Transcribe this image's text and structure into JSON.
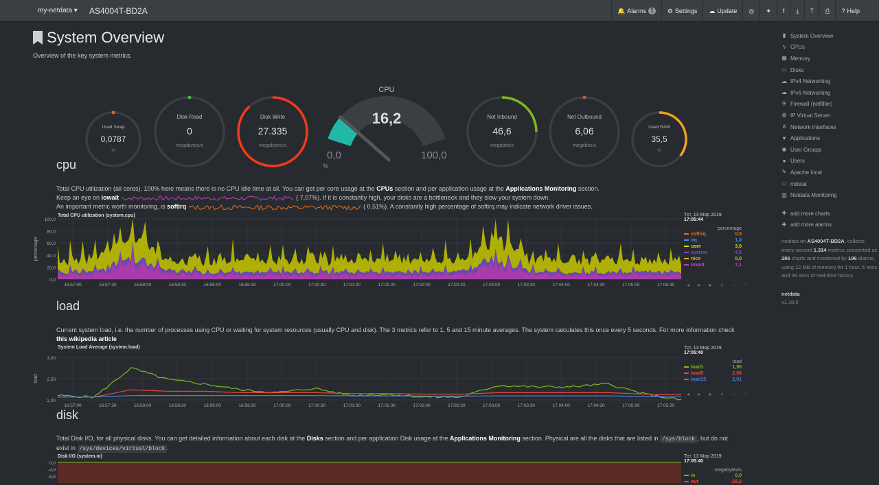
{
  "topbar": {
    "host": "my-netdata ▾",
    "title": "AS4004T-BD2A",
    "buttons": [
      {
        "icon": "bell-icon",
        "glyph": "🔔",
        "label": "Alarms",
        "badge": "1"
      },
      {
        "icon": "gear-icon",
        "glyph": "⚙",
        "label": "Settings"
      },
      {
        "icon": "cloud-download-icon",
        "glyph": "☁",
        "label": "Update"
      },
      {
        "icon": "github-icon",
        "glyph": "◎",
        "label": ""
      },
      {
        "icon": "twitter-icon",
        "glyph": "✦",
        "label": ""
      },
      {
        "icon": "facebook-icon",
        "glyph": "f",
        "label": ""
      },
      {
        "icon": "download-icon",
        "glyph": "⤓",
        "label": ""
      },
      {
        "icon": "upload-icon",
        "glyph": "⤒",
        "label": ""
      },
      {
        "icon": "print-icon",
        "glyph": "⎙",
        "label": ""
      },
      {
        "icon": "help-icon",
        "glyph": "?",
        "label": "Help"
      }
    ]
  },
  "page": {
    "title": "System Overview",
    "subtitle": "Overview of the key system metrics."
  },
  "gauges": {
    "swap": {
      "label": "Used Swap",
      "value": "0,0787",
      "unit": "%",
      "fraction": 0.0,
      "color": "#ff5722"
    },
    "disk_read": {
      "label": "Disk Read",
      "value": "0",
      "unit": "megabytes/s",
      "fraction": 0.0,
      "color": "#4caf50"
    },
    "disk_write": {
      "label": "Disk Write",
      "value": "27.335",
      "unit": "megabytes/s",
      "fraction": 0.88,
      "color": "#f4391c"
    },
    "cpu": {
      "label": "CPU",
      "value": "16,2",
      "min": "0,0",
      "max": "100,0",
      "unit": "%",
      "fraction": 0.162,
      "color": "#22b8a8"
    },
    "net_in": {
      "label": "Net Inbound",
      "value": "46,6",
      "unit": "megabits/s",
      "fraction": 0.25,
      "color": "#7cbb1d"
    },
    "net_out": {
      "label": "Net Outbound",
      "value": "6,06",
      "unit": "megabits/s",
      "fraction": 0.0,
      "color": "#e84a3c"
    },
    "ram": {
      "label": "Used RAM",
      "value": "35,5",
      "unit": "%",
      "fraction": 0.355,
      "color": "#f3a120"
    }
  },
  "sections": {
    "cpu": {
      "title": "cpu",
      "line1_a": "Total CPU utilization (all cores). 100% here means there is no CPU idle time at all. You can get per core usage at the ",
      "line1_b": "CPUs",
      "line1_c": " section and per application usage at the ",
      "line1_d": "Applications Monitoring",
      "line1_e": " section.",
      "line2_a": "Keep an eye on ",
      "line2_b": "iowait",
      "line2_c": "( 7,07%). If it is constantly high, your disks are a bottleneck and they slow your system down.",
      "line3_a": "An important metric worth monitoring, is ",
      "line3_b": "softirq",
      "line3_c": "( 0,51%). A constantly high percentage of softirq may indicate network driver issues."
    },
    "load": {
      "title": "load",
      "text_a": "Current system load, i.e. the number of processes using CPU or waiting for system resources (usually CPU and disk). The 3 metrics refer to 1, 5 and 15 minute averages. The system calculates this once every 5 seconds. For more information check ",
      "text_b": "this wikipedia article"
    },
    "disk": {
      "title": "disk",
      "text_a": "Total Disk I/O, for all physical disks. You can get detailed information about each disk at the ",
      "text_b": "Disks",
      "text_c": " section and per application Disk usage at the ",
      "text_d": "Applications Monitoring",
      "text_e": " section. Physical are all the disks that are listed in ",
      "code1": "/sys/block",
      "text_f": ", but do not exist in ",
      "code2": "/sys/devices/virtual/block",
      "text_g": "."
    }
  },
  "charts": {
    "cpu": {
      "title": "Total CPU utilization (system.cpu)",
      "ylabel": "percentage",
      "yticks": [
        "100,0",
        "80,0",
        "60,0",
        "40,0",
        "20,0",
        "0,0"
      ],
      "xticks": [
        "16:57:00",
        "16:57:30",
        "16:58:00",
        "16:58:30",
        "16:59:00",
        "16:59:30",
        "17:00:00",
        "17:00:30",
        "17:01:00",
        "17:01:30",
        "17:02:00",
        "17:02:30",
        "17:03:00",
        "17:03:30",
        "17:04:00",
        "17:04:30",
        "17:05:00",
        "17:05:30"
      ],
      "date": "Тст, 13 Мор 2019",
      "time": "17:05:44",
      "units": "percentage",
      "legend": [
        {
          "name": "softirq",
          "value": "0,5",
          "color": "#e07020"
        },
        {
          "name": "irq",
          "value": "1,0",
          "color": "#4a90d9"
        },
        {
          "name": "user",
          "value": "3,0",
          "color": "#dddd00"
        },
        {
          "name": "system",
          "value": "4,5",
          "color": "#7b4ccc"
        },
        {
          "name": "nice",
          "value": "0,0",
          "color": "#e8b010"
        },
        {
          "name": "iowait",
          "value": "7,1",
          "color": "#c040c0"
        }
      ]
    },
    "load": {
      "title": "System Load Average (system.load)",
      "ylabel": "load",
      "yticks": [
        "3,00",
        "2,50",
        "2,00"
      ],
      "xticks": [
        "16:57:00",
        "16:57:30",
        "16:58:00",
        "16:58:30",
        "16:59:00",
        "16:59:30",
        "17:00:00",
        "17:00:30",
        "17:01:00",
        "17:01:30",
        "17:02:00",
        "17:02:30",
        "17:03:00",
        "17:03:30",
        "17:04:00",
        "17:04:30",
        "17:05:00",
        "17:05:30"
      ],
      "date": "Тст, 13 Мор 2019",
      "time": "17:05:40",
      "units": "load",
      "legend": [
        {
          "name": "load1",
          "value": "1,90",
          "color": "#7cbb1d"
        },
        {
          "name": "load5",
          "value": "2,08",
          "color": "#e84a3c"
        },
        {
          "name": "load15",
          "value": "2,01",
          "color": "#4a7fd9"
        }
      ]
    },
    "disk": {
      "title": "Disk I/O (system.io)",
      "yticks": [
        "0,0",
        "-4,9",
        "-9,8"
      ],
      "date": "Тст, 13 Мор 2019",
      "time": "17:05:40",
      "units": "megabytes/s",
      "legend": [
        {
          "name": "in",
          "value": "0,0",
          "color": "#7cbb1d"
        },
        {
          "name": "out",
          "value": "-29,2",
          "color": "#e84a3c"
        }
      ]
    }
  },
  "chart_data": [
    {
      "type": "area",
      "title": "Total CPU utilization (system.cpu)",
      "ylabel": "percentage",
      "ylim": [
        0,
        100
      ],
      "x": [
        "16:57:00",
        "16:57:30",
        "16:58:00",
        "16:58:30",
        "16:59:00",
        "16:59:30",
        "17:00:00",
        "17:00:30",
        "17:01:00",
        "17:01:30",
        "17:02:00",
        "17:02:30",
        "17:03:00",
        "17:03:30",
        "17:04:00",
        "17:04:30",
        "17:05:00",
        "17:05:30"
      ],
      "series": [
        {
          "name": "iowait",
          "values": [
            7,
            8,
            25,
            9,
            7,
            6,
            7,
            8,
            7,
            6,
            7,
            8,
            25,
            7,
            6,
            7,
            7,
            7
          ]
        },
        {
          "name": "system",
          "values": [
            5,
            5,
            8,
            5,
            4,
            5,
            5,
            5,
            4,
            5,
            5,
            5,
            8,
            5,
            4,
            5,
            5,
            4
          ]
        },
        {
          "name": "user",
          "values": [
            20,
            22,
            45,
            18,
            20,
            22,
            18,
            24,
            20,
            22,
            20,
            18,
            40,
            20,
            22,
            20,
            18,
            20
          ]
        }
      ]
    },
    {
      "type": "line",
      "title": "System Load Average (system.load)",
      "ylabel": "load",
      "ylim": [
        1.9,
        3.1
      ],
      "x": [
        "16:57:00",
        "16:57:30",
        "16:58:00",
        "16:58:30",
        "16:59:00",
        "16:59:30",
        "17:00:00",
        "17:00:30",
        "17:01:00",
        "17:01:30",
        "17:02:00",
        "17:02:30",
        "17:03:00",
        "17:03:30",
        "17:04:00",
        "17:04:30",
        "17:05:00",
        "17:05:30"
      ],
      "series": [
        {
          "name": "load1",
          "values": [
            2.05,
            2.0,
            3.0,
            2.6,
            2.45,
            2.25,
            2.15,
            2.3,
            2.05,
            2.1,
            2.0,
            2.0,
            2.4,
            2.35,
            2.35,
            2.45,
            2.1,
            1.9
          ]
        },
        {
          "name": "load5",
          "values": [
            2.0,
            2.0,
            2.25,
            2.2,
            2.2,
            2.15,
            2.15,
            2.15,
            2.12,
            2.12,
            2.1,
            2.1,
            2.15,
            2.15,
            2.15,
            2.15,
            2.1,
            2.08
          ]
        },
        {
          "name": "load15",
          "values": [
            2.0,
            2.0,
            2.05,
            2.05,
            2.05,
            2.05,
            2.05,
            2.05,
            2.04,
            2.04,
            2.03,
            2.03,
            2.04,
            2.04,
            2.04,
            2.04,
            2.02,
            2.01
          ]
        }
      ]
    }
  ],
  "sidebar": {
    "items": [
      {
        "icon": "bookmark-icon",
        "glyph": "▮",
        "label": "System Overview"
      },
      {
        "icon": "bolt-icon",
        "glyph": "ϟ",
        "label": "CPUs"
      },
      {
        "icon": "memory-icon",
        "glyph": "▦",
        "label": "Memory"
      },
      {
        "icon": "hdd-icon",
        "glyph": "▭",
        "label": "Disks"
      },
      {
        "icon": "cloud-icon",
        "glyph": "☁",
        "label": "IPv4 Networking"
      },
      {
        "icon": "cloud-icon",
        "glyph": "☁",
        "label": "IPv6 Networking"
      },
      {
        "icon": "shield-icon",
        "glyph": "⛨",
        "label": "Firewall (netfilter)"
      },
      {
        "icon": "globe-icon",
        "glyph": "◍",
        "label": "IP Virtual Server"
      },
      {
        "icon": "sitemap-icon",
        "glyph": "⋔",
        "label": "Network Interfaces"
      },
      {
        "icon": "heartbeat-icon",
        "glyph": "♥",
        "label": "Applications"
      },
      {
        "icon": "users-icon",
        "glyph": "◉",
        "label": "User Groups"
      },
      {
        "icon": "user-icon",
        "glyph": "●",
        "label": "Users"
      },
      {
        "icon": "feather-icon",
        "glyph": "✎",
        "label": "Apache local"
      },
      {
        "icon": "hdd-icon",
        "glyph": "▭",
        "label": "mdstat"
      },
      {
        "icon": "bar-chart-icon",
        "glyph": "▥",
        "label": "Netdata Monitoring"
      }
    ],
    "add_charts": "add more charts",
    "add_alarms": "add more alarms",
    "info_a": "netdata on ",
    "info_host": "AS4004T-BD2A",
    "info_b": ", collects every second ",
    "info_metrics": "1.314",
    "info_c": " metrics, presented as ",
    "info_charts": "286",
    "info_d": " charts and monitored by ",
    "info_alarms": "196",
    "info_e": " alarms, using 22 MB of memory for 1 hour, 6 mins and 36 secs of real-time history.",
    "brand": "netdata",
    "version": "v1.10.0"
  }
}
